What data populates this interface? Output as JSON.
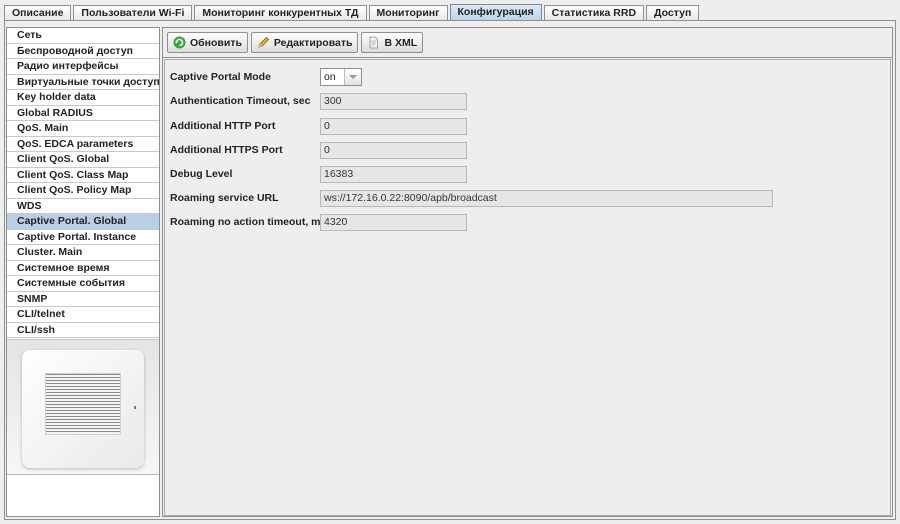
{
  "tabs": [
    {
      "label": "Описание"
    },
    {
      "label": "Пользователи Wi-Fi"
    },
    {
      "label": "Мониторинг конкурентных ТД"
    },
    {
      "label": "Мониторинг"
    },
    {
      "label": "Конфигурация"
    },
    {
      "label": "Статистика RRD"
    },
    {
      "label": "Доступ"
    }
  ],
  "active_tab": "Конфигурация",
  "sidebar": {
    "items": [
      {
        "label": "Сеть"
      },
      {
        "label": "Беспроводной доступ"
      },
      {
        "label": "Радио интерфейсы"
      },
      {
        "label": "Виртуальные точки доступа"
      },
      {
        "label": "Key holder data"
      },
      {
        "label": "Global RADIUS"
      },
      {
        "label": "QoS. Main"
      },
      {
        "label": "QoS. EDCA parameters"
      },
      {
        "label": "Client QoS. Global"
      },
      {
        "label": "Client QoS. Class Map"
      },
      {
        "label": "Client QoS. Policy Map"
      },
      {
        "label": "WDS"
      },
      {
        "label": "Captive Portal. Global"
      },
      {
        "label": "Captive Portal. Instance"
      },
      {
        "label": "Cluster. Main"
      },
      {
        "label": "Системное время"
      },
      {
        "label": "Системные события"
      },
      {
        "label": "SNMP"
      },
      {
        "label": "CLI/telnet"
      },
      {
        "label": "CLI/ssh"
      }
    ],
    "selected": "Captive Portal. Global"
  },
  "toolbar": {
    "refresh_label": "Обновить",
    "edit_label": "Редактировать",
    "xml_label": "В XML",
    "refresh_icon": "refresh-icon",
    "edit_icon": "pencil-icon",
    "xml_icon": "document-icon"
  },
  "form": {
    "captive_portal_mode": {
      "label": "Captive Portal Mode",
      "value": "on"
    },
    "auth_timeout": {
      "label": "Authentication Timeout, sec",
      "value": "300"
    },
    "http_port": {
      "label": "Additional HTTP Port",
      "value": "0"
    },
    "https_port": {
      "label": "Additional HTTPS Port",
      "value": "0"
    },
    "debug_level": {
      "label": "Debug Level",
      "value": "16383"
    },
    "roaming_url": {
      "label": "Roaming service URL",
      "value": "ws://172.16.0.22:8090/apb/broadcast"
    },
    "roaming_timeout": {
      "label": "Roaming no action timeout, min",
      "value": "4320"
    }
  },
  "colors": {
    "selected_bg": "#b8cfe5",
    "active_tab_bg": "#cde0f0",
    "field_bg": "#e6e6e6"
  }
}
